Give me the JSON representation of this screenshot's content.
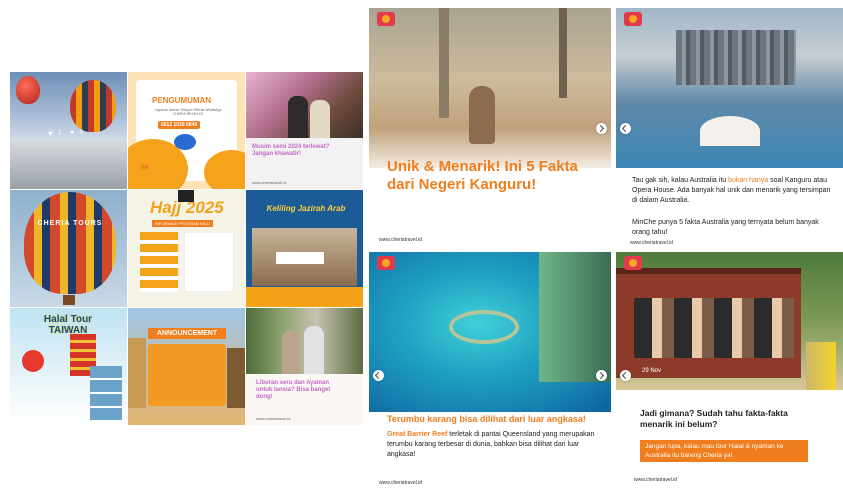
{
  "grid": {
    "t1": {
      "likes": "1",
      "comments": "0"
    },
    "t2": {
      "title": "PENGUMUMAN",
      "body": "Layanan Nomor Telepon Official WhatsApp CHERIA RESMI KE",
      "phone": "0812 1028 0849"
    },
    "t3": {
      "caption": "Musim semi 2024 terlewat? Jangan khawatir!",
      "site": "www.cheriatravel.id"
    },
    "t4": {
      "sign": "CHERIA TOURS"
    },
    "t5": {
      "title": "Hajj 2025",
      "subtitle": "INFORMASI PROGRAM HAJJ"
    },
    "t6": {
      "title": "Keliling Jazirah Arab"
    },
    "t7": {
      "title": "Halal Tour TAIWAN"
    },
    "t8": {
      "title": "ANNOUNCEMENT"
    },
    "t9": {
      "caption": "Liburan seru dan nyaman untuk lansia? Bisa banget dong!",
      "site": "www.cheriatravel.id"
    }
  },
  "cards": {
    "c1": {
      "headline": "Unik & Menarik! Ini 5 Fakta dari Negeri Kanguru!",
      "site": "www.cheriatravel.id"
    },
    "c2": {
      "para1_a": "Tau gak sih, kalau Australia itu ",
      "para1_hl": "bukan hanya",
      "para1_b": " soal Kanguru atau Opera House. Ada banyak hal unik dan menarik yang tersimpan di dalam Australia.",
      "para2": "MinChe punya 5 fakta Australia yang ternyata belum banyak orang tahu!",
      "site": "www.cheriatravel.id"
    },
    "c3": {
      "heading": "Terumbu karang bisa dilihat dari luar angkasa!",
      "hl": "Great Barrier Reef",
      "body": " terletak di pantai Queensland yang merupakan terumbu karang terbesar di dunia, bahkan bisa dilihat dari luar angkasa!",
      "site": "www.cheriatravel.id"
    },
    "c4": {
      "question": "Jadi gimana? Sudah tahu fakta-fakta menarik ini belum?",
      "cta": "Jangan lupa, kalau mau tour Halal & nyaman ke Australia itu bareng Cheria ya!",
      "site": "www.cheriatravel.id",
      "date": "29 Nov"
    }
  },
  "colors": {
    "accent": "#f07d1e",
    "brand_red": "#e23a4b"
  }
}
